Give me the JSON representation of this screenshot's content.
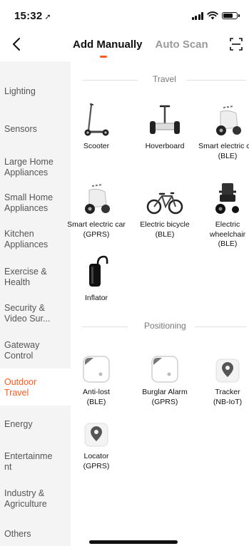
{
  "status_bar": {
    "time": "15:32",
    "location_arrow": "location-arrow-icon"
  },
  "nav": {
    "tabs": [
      {
        "label": "Add Manually",
        "active": true
      },
      {
        "label": "Auto Scan",
        "active": false
      }
    ],
    "accent_color": "#ff5a1f"
  },
  "sidebar": {
    "items": [
      {
        "label": "Lighting"
      },
      {
        "label": "Sensors"
      },
      {
        "label": "Large Home Appliances"
      },
      {
        "label": "Small Home Appliances"
      },
      {
        "label": "Kitchen Appliances"
      },
      {
        "label": "Exercise & Health"
      },
      {
        "label": "Security & Video Sur..."
      },
      {
        "label": "Gateway Control"
      },
      {
        "label": "Outdoor Travel",
        "active": true
      },
      {
        "label": "Energy"
      },
      {
        "label": "Entertainme nt"
      },
      {
        "label": "Industry & Agriculture"
      },
      {
        "label": "Others"
      }
    ]
  },
  "sections": [
    {
      "title": "Travel",
      "devices": [
        {
          "name": "Scooter",
          "icon": "scooter-icon"
        },
        {
          "name": "Hoverboard",
          "icon": "hoverboard-icon"
        },
        {
          "name": "Smart electric car\n(BLE)",
          "icon": "electric-car-icon"
        },
        {
          "name": "Smart electric car\n(GPRS)",
          "icon": "electric-car-icon"
        },
        {
          "name": "Electric bicycle\n(BLE)",
          "icon": "bicycle-icon"
        },
        {
          "name": "Electric wheelchair\n(BLE)",
          "icon": "wheelchair-icon"
        },
        {
          "name": "Inflator",
          "icon": "inflator-icon"
        }
      ]
    },
    {
      "title": "Positioning",
      "devices": [
        {
          "name": "Anti-lost\n(BLE)",
          "icon": "tag-icon"
        },
        {
          "name": "Burglar Alarm\n(GPRS)",
          "icon": "tag-icon"
        },
        {
          "name": "Tracker\n(NB-IoT)",
          "icon": "location-pin-icon"
        },
        {
          "name": "Locator\n(GPRS)",
          "icon": "location-pin-icon"
        }
      ]
    }
  ]
}
